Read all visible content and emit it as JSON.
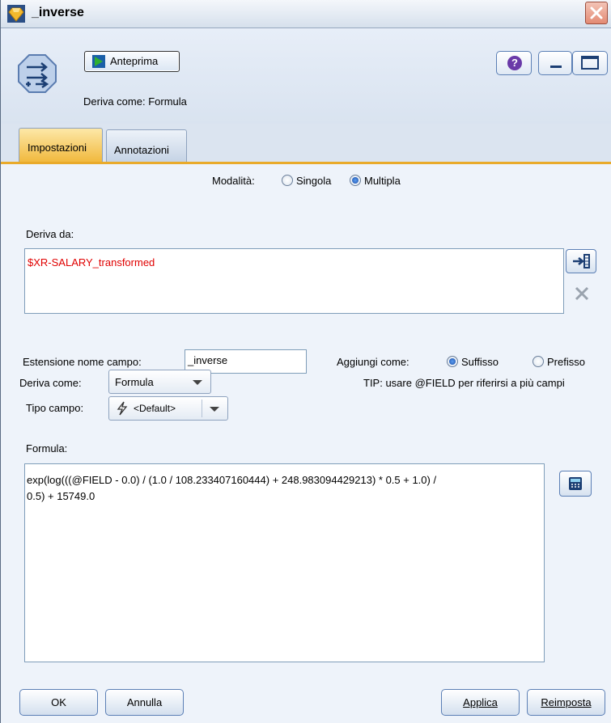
{
  "window": {
    "title": "_inverse"
  },
  "header": {
    "preview_label": "Anteprima",
    "subtitle": "Deriva come: Formula",
    "help_label": "?"
  },
  "tabs": [
    {
      "label": "Impostazioni",
      "active": true
    },
    {
      "label": "Annotazioni",
      "active": false
    }
  ],
  "mode": {
    "label": "Modalità:",
    "options": [
      {
        "label": "Singola",
        "selected": false
      },
      {
        "label": "Multipla",
        "selected": true
      }
    ]
  },
  "derive_from": {
    "label": "Deriva da:",
    "fields": [
      "$XR-SALARY_transformed"
    ],
    "field_color": "#e00000"
  },
  "extension": {
    "label": "Estensione nome campo:",
    "value": "_inverse",
    "add_as_label": "Aggiungi come:",
    "options": [
      {
        "label": "Suffisso",
        "selected": true
      },
      {
        "label": "Prefisso",
        "selected": false
      }
    ]
  },
  "derive_as": {
    "label": "Deriva come:",
    "value": "Formula",
    "tip": "TIP: usare @FIELD per riferirsi a più campi"
  },
  "field_type": {
    "label": "Tipo campo:",
    "value": "<Default>"
  },
  "formula": {
    "label": "Formula:",
    "line1": "exp(log(((@FIELD - 0.0) / (1.0 / 108.233407160444) + 248.983094429213) * 0.5 + 1.0) /",
    "line2": "0.5) + 15749.0"
  },
  "footer": {
    "ok": "OK",
    "cancel": "Annulla",
    "apply": "Applica",
    "reset": "Reimposta"
  },
  "colors": {
    "accent_tab": "#f1b93e",
    "window_bg": "#eef3fa",
    "field_text": "#e00000"
  }
}
